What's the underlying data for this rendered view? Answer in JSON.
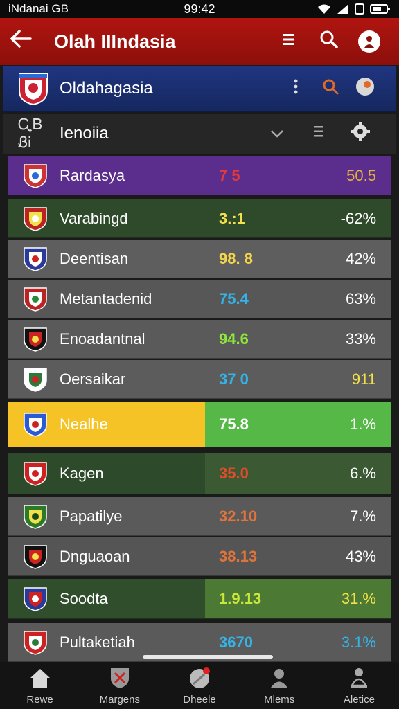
{
  "status": {
    "carrier": "iNdanai GB",
    "time": "99:42"
  },
  "appbar": {
    "title": "Olah IIIndasia"
  },
  "team_header": {
    "name": "Oldahagasia"
  },
  "filter": {
    "label": "Ienoiia",
    "prefix": "ᏩᏴ ᏰᎥ"
  },
  "rows": [
    {
      "name": "Rardasya",
      "v1": "7 5",
      "v2": "50.5",
      "bg": "#5b2d8c",
      "v1_color": "#e23a3a",
      "v2_color": "#e2b23a",
      "seg": ""
    },
    {
      "name": "Varabingd",
      "v1": "3.:1",
      "v2": "-62%",
      "bg": "#2f4a2a",
      "v1_color": "#f3e04a",
      "v2_color": "#ffffff",
      "seg": ""
    },
    {
      "name": "Deentisan",
      "v1": "98. 8",
      "v2": "42%",
      "bg": "#5e5e5e",
      "v1_color": "#f3d44a",
      "v2_color": "#ffffff",
      "seg": ""
    },
    {
      "name": "Metantadenid",
      "v1": "75.4",
      "v2": "63%",
      "bg": "#575757",
      "v1_color": "#34b4e6",
      "v2_color": "#ffffff",
      "seg": ""
    },
    {
      "name": "Enoadantnal",
      "v1": "94.6",
      "v2": "33%",
      "bg": "#5a5a5a",
      "v1_color": "#8ee83a",
      "v2_color": "#ffffff",
      "seg": ""
    },
    {
      "name": "Oersaikar",
      "v1": "37 0",
      "v2": "911",
      "bg": "#5c5c5c",
      "v1_color": "#34b4e6",
      "v2_color": "#f3e04a",
      "seg": ""
    },
    {
      "name": "Nealhe",
      "v1": "75.8",
      "v2": "1.%",
      "bg": "#f5c326",
      "v1_color": "#ffffff",
      "v2_color": "#ffffff",
      "seg": "#56b847"
    },
    {
      "name": "Kagen",
      "v1": "35.0",
      "v2": "6.%",
      "bg": "#2d4a2a",
      "v1_color": "#e24a2a",
      "v2_color": "#ffffff",
      "seg": "#3b5a33"
    },
    {
      "name": "Papatilye",
      "v1": "32.10",
      "v2": "7.%",
      "bg": "#5a5a5a",
      "v1_color": "#e0733a",
      "v2_color": "#ffffff",
      "seg": ""
    },
    {
      "name": "Dnguaoan",
      "v1": "38.13",
      "v2": "43%",
      "bg": "#555555",
      "v1_color": "#e0733a",
      "v2_color": "#ffffff",
      "seg": ""
    },
    {
      "name": "Soodta",
      "v1": "1.9.13",
      "v2": "31.%",
      "bg": "#304d2c",
      "v1_color": "#c8e83a",
      "v2_color": "#f3e04a",
      "seg": "#4c7a35"
    },
    {
      "name": "Pultaketiah",
      "v1": "3670",
      "v2": "3.1%",
      "bg": "#5a5a5a",
      "v1_color": "#34b4e6",
      "v2_color": "#34b4e6",
      "seg": ""
    }
  ],
  "nav": [
    {
      "label": "Rewe",
      "icon": "home-icon"
    },
    {
      "label": "Margens",
      "icon": "shield-icon"
    },
    {
      "label": "Dheele",
      "icon": "ball-icon"
    },
    {
      "label": "Mlems",
      "icon": "person-icon"
    },
    {
      "label": "Aletice",
      "icon": "trophy-icon"
    }
  ]
}
